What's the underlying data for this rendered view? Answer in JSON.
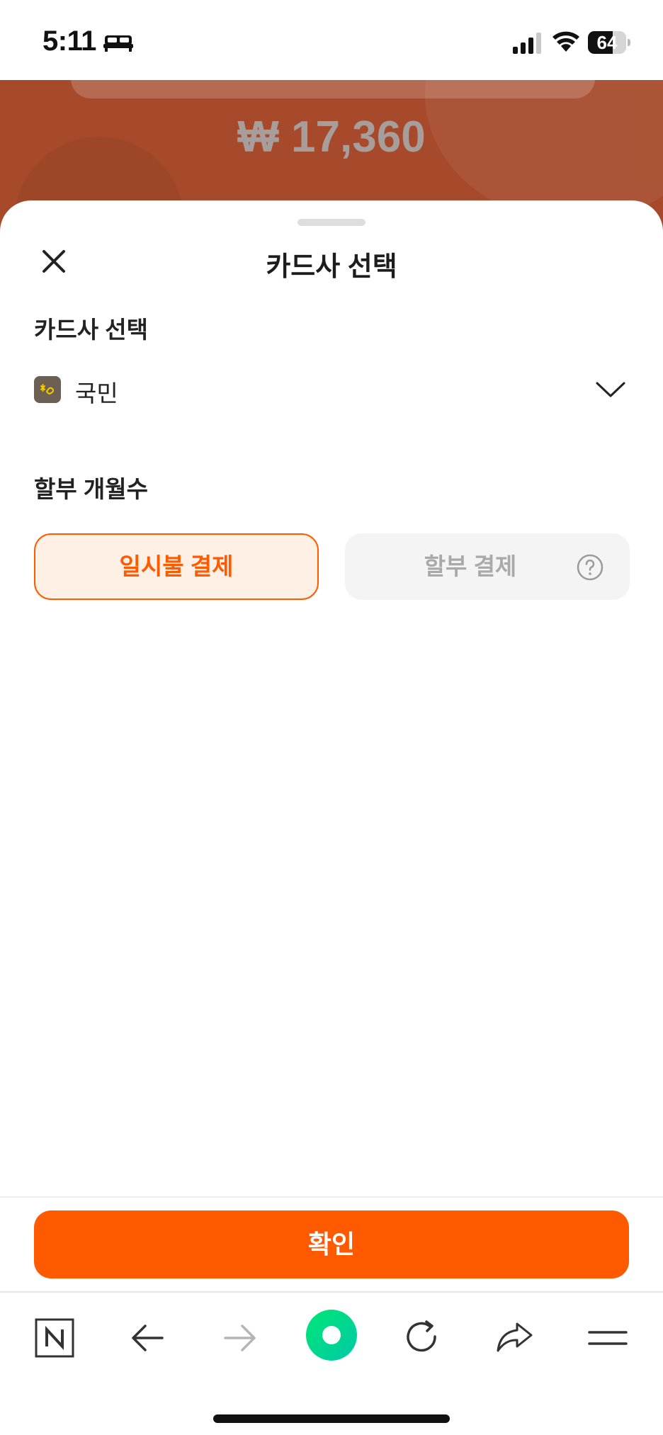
{
  "status_bar": {
    "time": "5:11",
    "battery_percent": "64",
    "battery_level": 0.64,
    "icons": [
      "bed-icon",
      "cellular-signal-icon",
      "wifi-icon",
      "battery-icon"
    ]
  },
  "background_page": {
    "amount": "₩ 17,360"
  },
  "sheet": {
    "title": "카드사 선택",
    "close_icon": "close-icon",
    "card_company_label": "카드사 선택",
    "selected_card": "국민",
    "card_logo_icon": "kb-bank-logo-icon",
    "dropdown_icon": "chevron-down-icon",
    "installment_label": "할부 개월수",
    "options": {
      "lump_sum": "일시불 결제",
      "installment": "할부 결제",
      "selected": "lump_sum"
    },
    "help_icon": "help-circle-icon",
    "confirm_label": "확인"
  },
  "browser_toolbar": {
    "items": [
      "naver-home-icon",
      "back-arrow-icon",
      "forward-arrow-icon",
      "green-dot-icon",
      "reload-icon",
      "share-icon",
      "menu-icon"
    ]
  },
  "colors": {
    "accent": "#ff5a00",
    "accent_light": "#fff0e6",
    "background_header": "#a64a2b",
    "disabled_text": "#a9a9a9",
    "green_button": "#1ed760"
  }
}
